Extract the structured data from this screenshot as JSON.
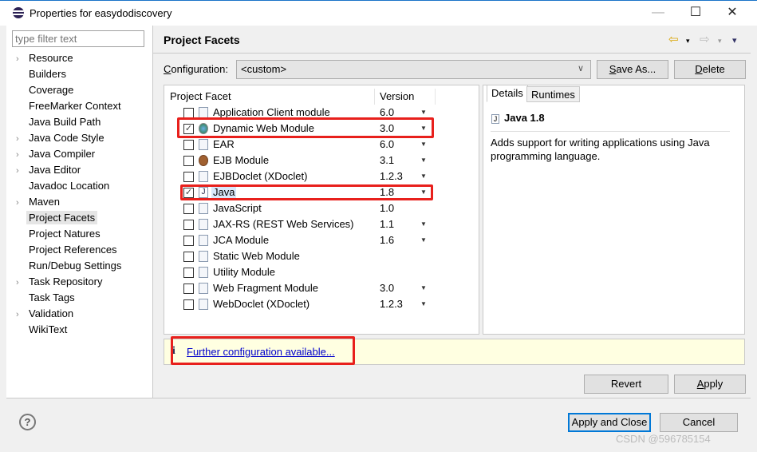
{
  "window": {
    "title": "Properties for easydodiscovery",
    "minimize": "—",
    "maximize": "☐",
    "close": "✕"
  },
  "filter": {
    "placeholder": "type filter text"
  },
  "tree": [
    {
      "label": "Resource",
      "expandable": true
    },
    {
      "label": "Builders"
    },
    {
      "label": "Coverage"
    },
    {
      "label": "FreeMarker Context"
    },
    {
      "label": "Java Build Path"
    },
    {
      "label": "Java Code Style",
      "expandable": true
    },
    {
      "label": "Java Compiler",
      "expandable": true
    },
    {
      "label": "Java Editor",
      "expandable": true
    },
    {
      "label": "Javadoc Location"
    },
    {
      "label": "Maven",
      "expandable": true
    },
    {
      "label": "Project Facets",
      "selected": true
    },
    {
      "label": "Project Natures"
    },
    {
      "label": "Project References"
    },
    {
      "label": "Run/Debug Settings"
    },
    {
      "label": "Task Repository",
      "expandable": true
    },
    {
      "label": "Task Tags"
    },
    {
      "label": "Validation",
      "expandable": true
    },
    {
      "label": "WikiText"
    }
  ],
  "header": {
    "title": "Project Facets",
    "back": "⇦",
    "forward": "⇨",
    "menu": "▾"
  },
  "configuration": {
    "label_pre": "C",
    "label_rest": "onfiguration:",
    "value": "<custom>",
    "save_as_u": "S",
    "save_as_rest": "ave As...",
    "delete_u": "D",
    "delete_rest": "elete"
  },
  "facets": {
    "col_facet": "Project Facet",
    "col_version": "Version",
    "rows": [
      {
        "name": "Application Client module",
        "version": "6.0",
        "checked": false,
        "dropdown": true,
        "icon": "doc"
      },
      {
        "name": "Dynamic Web Module",
        "version": "3.0",
        "checked": true,
        "dropdown": true,
        "icon": "globe"
      },
      {
        "name": "EAR",
        "version": "6.0",
        "checked": false,
        "dropdown": true,
        "icon": "doc"
      },
      {
        "name": "EJB Module",
        "version": "3.1",
        "checked": false,
        "dropdown": true,
        "icon": "bean"
      },
      {
        "name": "EJBDoclet (XDoclet)",
        "version": "1.2.3",
        "checked": false,
        "dropdown": true,
        "icon": "doc"
      },
      {
        "name": "Java",
        "version": "1.8",
        "checked": true,
        "dropdown": true,
        "icon": "j",
        "highlight": true
      },
      {
        "name": "JavaScript",
        "version": "1.0",
        "checked": false,
        "dropdown": false,
        "icon": "doc"
      },
      {
        "name": "JAX-RS (REST Web Services)",
        "version": "1.1",
        "checked": false,
        "dropdown": true,
        "icon": "doc"
      },
      {
        "name": "JCA Module",
        "version": "1.6",
        "checked": false,
        "dropdown": true,
        "icon": "doc"
      },
      {
        "name": "Static Web Module",
        "version": "",
        "checked": false,
        "dropdown": false,
        "icon": "doc"
      },
      {
        "name": "Utility Module",
        "version": "",
        "checked": false,
        "dropdown": false,
        "icon": "doc"
      },
      {
        "name": "Web Fragment Module",
        "version": "3.0",
        "checked": false,
        "dropdown": true,
        "icon": "doc"
      },
      {
        "name": "WebDoclet (XDoclet)",
        "version": "1.2.3",
        "checked": false,
        "dropdown": true,
        "icon": "doc"
      }
    ]
  },
  "details": {
    "tab_details": "Details",
    "tab_runtimes": "Runtimes",
    "title": "Java 1.8",
    "description": "Adds support for writing applications using Java programming language."
  },
  "info": {
    "icon": "i",
    "link": "Further configuration available..."
  },
  "buttons": {
    "revert": "Revert",
    "apply_u": "A",
    "apply_rest": "pply",
    "apply_close": "Apply and Close",
    "cancel": "Cancel"
  },
  "help": "?",
  "watermark": "CSDN @596785154",
  "colors": {
    "highlight_box": "#e8201c",
    "info_bg": "#ffffe1",
    "link": "#0000cc",
    "default_button_border": "#0078d7"
  }
}
